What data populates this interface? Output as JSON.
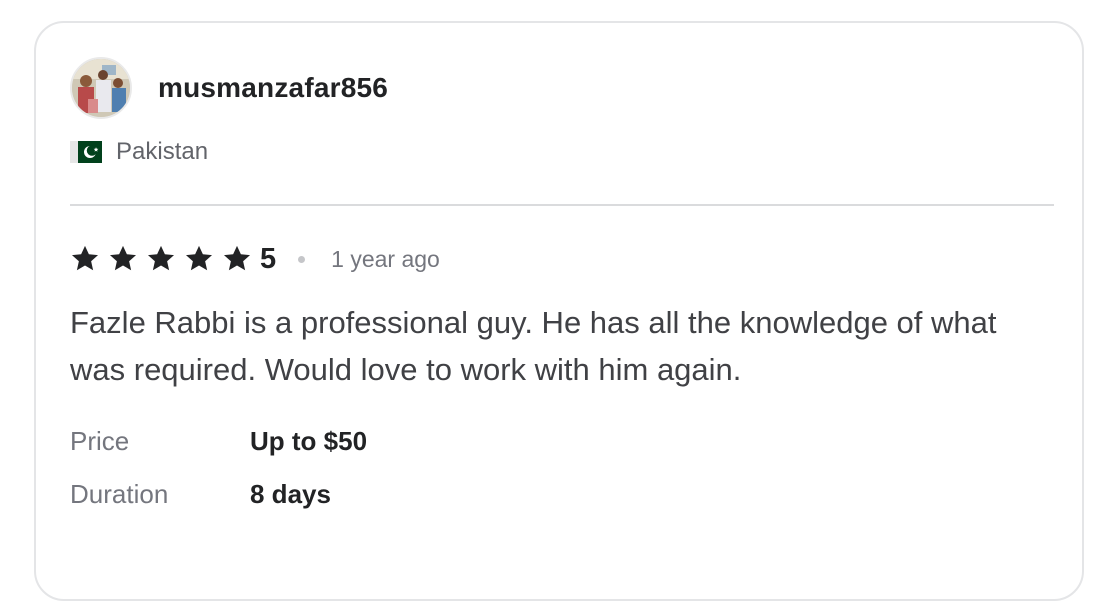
{
  "review": {
    "username": "musmanzafar856",
    "country": "Pakistan",
    "rating": "5",
    "rating_value": 5,
    "rating_max": 5,
    "time_ago": "1 year ago",
    "text": "Fazle Rabbi is a professional guy. He has all the knowledge of what was required. Would love to work with him again.",
    "price_label": "Price",
    "price_value": "Up to $50",
    "duration_label": "Duration",
    "duration_value": "8 days"
  },
  "icons": {
    "avatar": "user-avatar-photo",
    "flag": "pakistan-flag-icon",
    "star": "star-icon"
  },
  "colors": {
    "star": "#222325",
    "flag_green": "#01411c"
  }
}
